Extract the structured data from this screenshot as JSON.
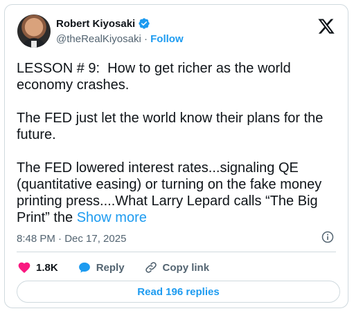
{
  "tweet": {
    "author_name": "Robert Kiyosaki",
    "handle": "@theRealKiyosaki",
    "separator": "·",
    "follow_label": "Follow",
    "text": "LESSON # 9:  How to get richer as the world economy crashes.\n\nThe FED just let the world know their plans for the future.\n\nThe FED lowered interest rates...signaling QE (quantitative easing) or turning on the fake money printing press....What Larry Lepard calls “The Big Print” the ",
    "show_more_label": "Show more",
    "timestamp": "8:48 PM · Dec 17, 2025"
  },
  "actions": {
    "like_count": "1.8K",
    "reply_label": "Reply",
    "copy_link_label": "Copy link"
  },
  "replies_button_label": "Read 196 replies",
  "colors": {
    "accent": "#1d9bf0",
    "like": "#f91880",
    "muted": "#536471",
    "border": "#cfd9de"
  },
  "icons": {
    "verified": "verified-badge-icon",
    "brand": "x-logo-icon",
    "info": "info-icon",
    "like": "heart-icon",
    "reply": "speech-bubble-icon",
    "copy_link": "link-icon"
  }
}
